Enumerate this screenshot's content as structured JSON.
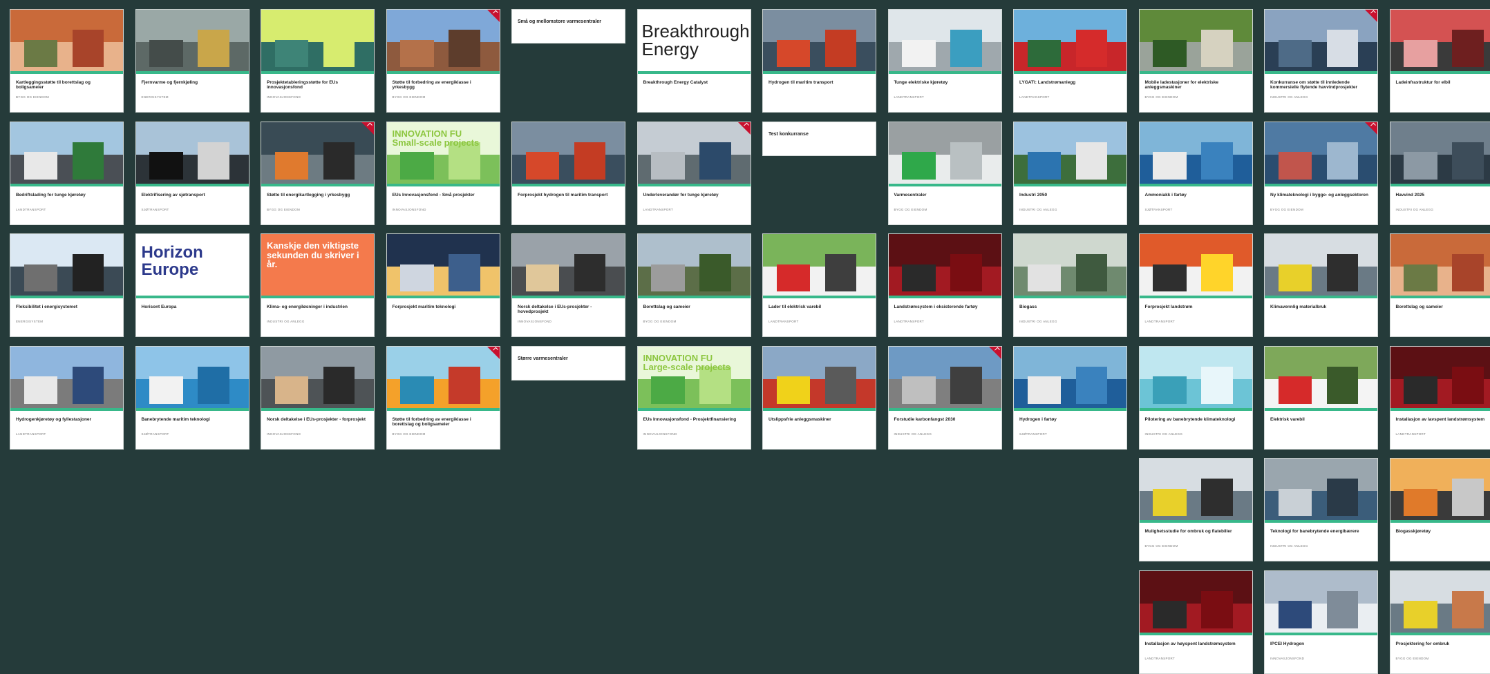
{
  "cards": [
    {
      "col": 0,
      "row": 0,
      "title": "Kartleggingsstøtte til borettslag og boligsameier",
      "sub": "BYGG OG EIENDOM",
      "img": "#c96a3a|#e8b28b|#6b7a45|#a8442a",
      "flag": false
    },
    {
      "col": 1,
      "row": 0,
      "title": "Fjernvarme og fjernkjøling",
      "sub": "ENERGISYSTEM",
      "img": "#9aa8a6|#5d6966|#444c4a|#c9a64a",
      "flag": false
    },
    {
      "col": 2,
      "row": 0,
      "title": "Prosjektetableringsstøtte for EUs innovasjonsfond",
      "sub": "INNOVASJONSFOND",
      "img": "#d7ec6f|#2f6e64|#3e8477|#d7ec6f",
      "flag": false
    },
    {
      "col": 3,
      "row": 0,
      "title": "Støtte til forbedring av energiklasse i yrkesbygg",
      "sub": "BYGG OG EIENDOM",
      "img": "#7fa8d8|#8e5a3e|#b4714a|#5d3d2c",
      "flag": true
    },
    {
      "col": 4,
      "row": 0,
      "title": "Små og mellomstore varmesentraler",
      "sub": "",
      "img": "",
      "flag": false,
      "textonly": true
    },
    {
      "col": 5,
      "row": 0,
      "title": "Breakthrough Energy Catalyst",
      "sub": "",
      "img": "#ffffff|#ffffff|#ffffff|#ffffff",
      "flag": false,
      "logo": "Breakthrough\nEnergy"
    },
    {
      "col": 6,
      "row": 0,
      "title": "Hydrogen til maritim transport",
      "sub": "",
      "img": "#7b8ea0|#3a4e5e|#d6482a|#c43c23",
      "flag": false
    },
    {
      "col": 7,
      "row": 0,
      "title": "Tunge elektriske kjøretøy",
      "sub": "LANDTRANSPORT",
      "img": "#dfe6ea|#9fa8ad|#f2f2f2|#3b9ec0",
      "flag": false
    },
    {
      "col": 8,
      "row": 0,
      "title": "LYGATI: Landstrømanlegg",
      "sub": "LANDTRANSPORT",
      "img": "#6db0dc|#c8262a|#2d6b3a|#d52b2b",
      "flag": false
    },
    {
      "col": 9,
      "row": 0,
      "title": "Mobile ladestasjoner for elektriske anleggsmaskiner",
      "sub": "BYGG OG EIENDOM",
      "img": "#5f8a3a|#9aa39a|#2e5a25|#d6d2c0",
      "flag": false
    },
    {
      "col": 10,
      "row": 0,
      "title": "Konkurranse om støtte til innledende kommersielle flytende havvindprosjekter",
      "sub": "INDUSTRI OG ANLEGG",
      "img": "#8aa3c0|#2a3f55|#4e6b87|#d7dde5",
      "flag": true
    },
    {
      "col": 11,
      "row": 0,
      "title": "Ladeinfrastruktur for elbil",
      "sub": "",
      "img": "#d45252|#3a3a3a|#e7a0a0|#6e1f1f",
      "flag": false
    },
    {
      "col": 0,
      "row": 1,
      "title": "Bedriftslading for tunge kjøretøy",
      "sub": "LANDTRANSPORT",
      "img": "#a3c6e0|#4a4f55|#e8e8e8|#2f7a3a",
      "flag": false
    },
    {
      "col": 1,
      "row": 1,
      "title": "Elektrifisering av sjøtransport",
      "sub": "SJØTRANSPORT",
      "img": "#a9c3d8|#2c3338|#111111|#d3d3d3",
      "flag": false
    },
    {
      "col": 2,
      "row": 1,
      "title": "Støtte til energikartlegging i yrkesbygg",
      "sub": "BYGG OG EIENDOM",
      "img": "#394b55|#6d7b82|#e07a2e|#2a2a2a",
      "flag": true
    },
    {
      "col": 3,
      "row": 1,
      "title": "EUs Innovasjonsfond - Små prosjekter",
      "sub": "INNOVASJONSFOND",
      "img": "#e9f7d9|#7cc05a|#4caa45|#b4e083",
      "flag": false,
      "overlay": "INNOVATION FU\nSmall-scale projects",
      "overlayColor": "#8cc63f"
    },
    {
      "col": 4,
      "row": 1,
      "title": "Forprosjekt hydrogen til maritim transport",
      "sub": "",
      "img": "#7b8ea0|#3a4e5e|#d6482a|#c43c23",
      "flag": false
    },
    {
      "col": 5,
      "row": 1,
      "title": "Underleverandør for tunge kjøretøy",
      "sub": "LANDTRANSPORT",
      "img": "#c5ccd3|#5f6b70|#b7bdc2|#2c4a6a",
      "flag": true
    },
    {
      "col": 6,
      "row": 1,
      "title": "Test konkurranse",
      "sub": "",
      "img": "",
      "flag": false,
      "textonly": true
    },
    {
      "col": 7,
      "row": 1,
      "title": "Varmesentraler",
      "sub": "BYGG OG EIENDOM",
      "img": "#9aa0a2|#e9ecec|#2fa84a|#b9c0c2",
      "flag": false
    },
    {
      "col": 8,
      "row": 1,
      "title": "Industri 2050",
      "sub": "INDUSTRI OG ANLEGG",
      "img": "#9cc2df|#3d6e3c|#2c74b0|#e6e6e6",
      "flag": false
    },
    {
      "col": 9,
      "row": 1,
      "title": "Ammoniakk i fartøy",
      "sub": "SJØTRANSPORT",
      "img": "#7fb5d8|#1f5e9a|#eaeaea|#3a82be",
      "flag": false
    },
    {
      "col": 10,
      "row": 1,
      "title": "Ny klimateknologi i bygge- og anleggsektoren",
      "sub": "BYGG OG EIENDOM",
      "img": "#4f7aa3|#2a4d70|#c1554c|#9db7cf",
      "flag": true
    },
    {
      "col": 11,
      "row": 1,
      "title": "Havvind 2025",
      "sub": "INDUSTRI OG ANLEGG",
      "img": "#6f7f8c|#2c3a45|#8c99a4|#3d4d5a",
      "flag": false
    },
    {
      "col": 0,
      "row": 2,
      "title": "Fleksibilitet i energisystemet",
      "sub": "ENERGISYSTEM",
      "img": "#dbe8f3|#3b4a55|#6f6f6f|#222222",
      "flag": false
    },
    {
      "col": 1,
      "row": 2,
      "title": "Horisont Europa",
      "sub": "",
      "img": "#ffffff|#ffffff|#ffffff|#ffffff",
      "flag": false,
      "overlay": "Horizon\nEurope",
      "overlayColor": "#2d3a8c"
    },
    {
      "col": 2,
      "row": 2,
      "title": "Klima- og energiløsninger i industrien",
      "sub": "INDUSTRI OG ANLEGG",
      "img": "#f47a4c|#f47a4c|#f47a4c|#f47a4c",
      "flag": false,
      "overlay": "Kanskje den viktigste sekunden du skriver i år.",
      "overlayColor": "#ffffff"
    },
    {
      "col": 3,
      "row": 2,
      "title": "Forprosjekt maritim teknologi",
      "sub": "",
      "img": "#20324e|#f0c36a|#cfd6e0|#3d5f8c",
      "flag": false
    },
    {
      "col": 4,
      "row": 2,
      "title": "Norsk deltakelse i EUs-prosjekter - hovedprosjekt",
      "sub": "INNOVASJONSFOND",
      "img": "#9aa2a9|#4a4d50|#e0c79a|#2d2d2d",
      "flag": false
    },
    {
      "col": 5,
      "row": 2,
      "title": "Borettslag og sameier",
      "sub": "BYGG OG EIENDOM",
      "img": "#aebfcc|#5c6e48|#9c9c9c|#3a5a2a",
      "flag": false
    },
    {
      "col": 6,
      "row": 2,
      "title": "Lader til elektrisk varebil",
      "sub": "LANDTRANSPORT",
      "img": "#7ab45a|#f2f2f2|#d62a2a|#3e3e3e",
      "flag": false
    },
    {
      "col": 7,
      "row": 2,
      "title": "Landstrømsystem i eksisterende fartøy",
      "sub": "LANDTRANSPORT",
      "img": "#5c1014|#a21a22|#2a2a2a|#7a0d12",
      "flag": false
    },
    {
      "col": 8,
      "row": 2,
      "title": "Biogass",
      "sub": "INDUSTRI OG ANLEGG",
      "img": "#cfd8cf|#6f8a6f|#e2e2e2|#3f5a3f",
      "flag": false
    },
    {
      "col": 9,
      "row": 2,
      "title": "Forprosjekt landstrøm",
      "sub": "LANDTRANSPORT",
      "img": "#e05a2a|#f2f2f2|#2f2f2f|#ffd42a",
      "flag": false
    },
    {
      "col": 10,
      "row": 2,
      "title": "Klimavennlig materialbruk",
      "sub": "",
      "img": "#d7dde2|#6a7a85|#e8d02a|#2e2e2e",
      "flag": false
    },
    {
      "col": 11,
      "row": 2,
      "title": "Borettslag og sameier",
      "sub": "",
      "img": "#c96a3a|#e8b28b|#6b7a45|#a8442a",
      "flag": false
    },
    {
      "col": 0,
      "row": 3,
      "title": "Hydrogenkjøretøy og fyllestasjoner",
      "sub": "LANDTRANSPORT",
      "img": "#8fb6de|#7b7b7b|#e8e8e8|#2d4a7a",
      "flag": false
    },
    {
      "col": 1,
      "row": 3,
      "title": "Banebrytende maritim teknologi",
      "sub": "SJØTRANSPORT",
      "img": "#8ec4e8|#2e8bc6|#f2f2f2|#1f6ea6",
      "flag": false
    },
    {
      "col": 2,
      "row": 3,
      "title": "Norsk deltakelse i EUs-prosjekter - forprosjekt",
      "sub": "INNOVASJONSFOND",
      "img": "#8f9aa2|#4e5356|#d8b48a|#2a2a2a",
      "flag": false
    },
    {
      "col": 3,
      "row": 3,
      "title": "Støtte til forbedring av energiklasse i borettslag og boligsameier",
      "sub": "BYGG OG EIENDOM",
      "img": "#9ad0e8|#f4a12a|#2a8bb4|#c53a2a",
      "flag": true
    },
    {
      "col": 4,
      "row": 3,
      "title": "Større varmesentraler",
      "sub": "",
      "img": "",
      "flag": false,
      "textonly": true
    },
    {
      "col": 5,
      "row": 3,
      "title": "EUs Innovasjonsfond - Prosjektfinansiering",
      "sub": "INNOVASJONSFOND",
      "img": "#e9f7d9|#7cc05a|#4caa45|#b4e083",
      "flag": false,
      "overlay": "INNOVATION FU\nLarge-scale projects",
      "overlayColor": "#8cc63f"
    },
    {
      "col": 6,
      "row": 3,
      "title": "Utslippsfrie anleggsmaskiner",
      "sub": "",
      "img": "#8ba8c6|#c4382a|#f0d21a|#5a5a5a",
      "flag": false
    },
    {
      "col": 7,
      "row": 3,
      "title": "Forstudie karbonfangst 2030",
      "sub": "INDUSTRI OG ANLEGG",
      "img": "#6e9ac4|#7f7f7f|#bfbfbf|#3f3f3f",
      "flag": true
    },
    {
      "col": 8,
      "row": 3,
      "title": "Hydrogen i fartøy",
      "sub": "SJØTRANSPORT",
      "img": "#7fb5d8|#1f5e9a|#eaeaea|#3a82be",
      "flag": false
    },
    {
      "col": 9,
      "row": 3,
      "title": "Pilotering av banebrytende klimateknologi",
      "sub": "INDUSTRI OG ANLEGG",
      "img": "#bfe7f0|#6cc4d6|#3aa0b8|#e8f6fa",
      "flag": false
    },
    {
      "col": 10,
      "row": 3,
      "title": "Elektrisk varebil",
      "sub": "",
      "img": "#7ea85a|#f4f4f4|#d62a2a|#3a5a2a",
      "flag": false
    },
    {
      "col": 11,
      "row": 3,
      "title": "Installasjon av lavspent landstrømsystem",
      "sub": "LANDTRANSPORT",
      "img": "#5c1014|#a21a22|#2a2a2a|#7a0d12",
      "flag": false
    },
    {
      "col": 9,
      "row": 4,
      "title": "Mulighetsstudie for ombruk og flatebiller",
      "sub": "BYGG OG EIENDOM",
      "img": "#d7dde2|#6a7a85|#e8d02a|#2e2e2e",
      "flag": false
    },
    {
      "col": 10,
      "row": 4,
      "title": "Teknologi for banebrytende energibærere",
      "sub": "INDUSTRI OG ANLEGG",
      "img": "#9aa6ae|#3b5d7a|#c9d0d6|#2a3a48",
      "flag": false
    },
    {
      "col": 11,
      "row": 4,
      "title": "Biogasskjøretøy",
      "sub": "",
      "img": "#f0b05a|#3a3a3a|#e07a2a|#c8c8c8",
      "flag": false
    },
    {
      "col": 9,
      "row": 5,
      "title": "Installasjon av høyspent landstrømsystem",
      "sub": "LANDTRANSPORT",
      "img": "#5c1014|#a21a22|#2a2a2a|#7a0d12",
      "flag": false
    },
    {
      "col": 10,
      "row": 5,
      "title": "IPCEI Hydrogen",
      "sub": "INNOVASJONSFOND",
      "img": "#aebccb|#eaeef2|#2d4a7a|#7f8c99",
      "flag": false
    },
    {
      "col": 11,
      "row": 5,
      "title": "Prosjektering for ombruk",
      "sub": "BYGG OG EIENDOM",
      "img": "#d7dde2|#6a7a85|#e8d02a|#c8794a",
      "flag": false
    }
  ]
}
